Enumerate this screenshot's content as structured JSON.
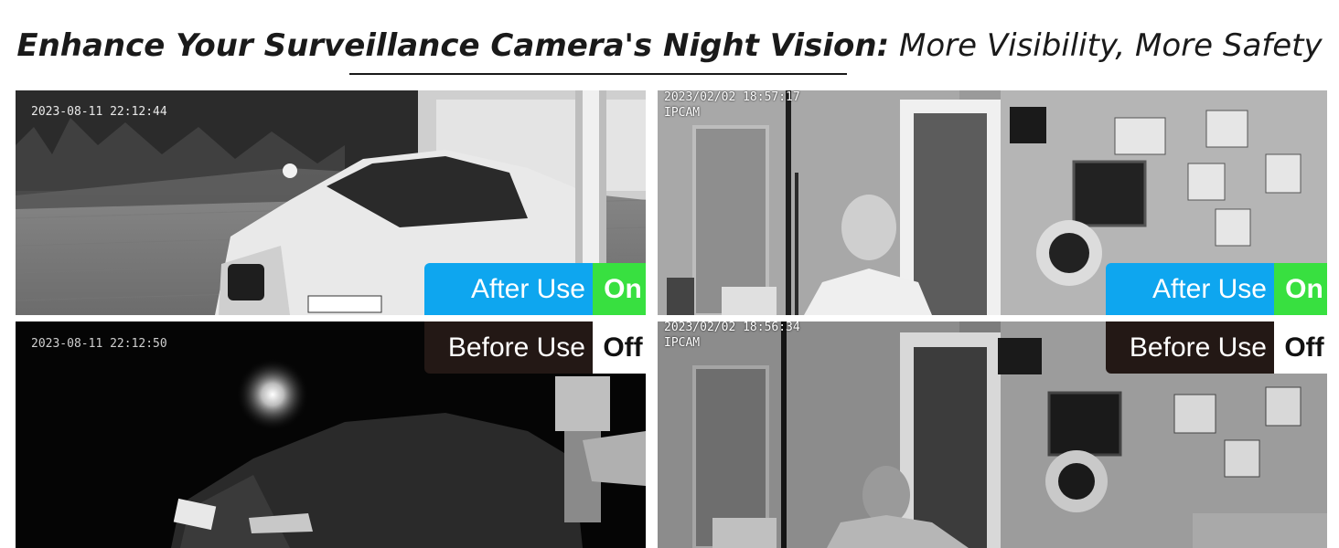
{
  "header": {
    "title_bold": "Enhance Your Surveillance Camera's Night Vision:",
    "title_light": "More Visibility, More Safety"
  },
  "panels": {
    "outdoor_after": {
      "timestamp": "2023-08-11 22:12:44",
      "badge_label": "After Use",
      "badge_state": "On"
    },
    "indoor_after": {
      "timestamp": "2023/02/02 18:57:17",
      "camera_name": "IPCAM",
      "badge_label": "After Use",
      "badge_state": "On"
    },
    "outdoor_before": {
      "timestamp": "2023-08-11 22:12:50",
      "badge_label": "Before Use",
      "badge_state": "Off"
    },
    "indoor_before": {
      "timestamp": "2023/02/02 18:56:34",
      "camera_name": "IPCAM",
      "badge_label": "Before Use",
      "badge_state": "Off"
    }
  },
  "colors": {
    "after_badge": "#0ea6ef",
    "on_badge": "#38e040",
    "before_badge": "#231815",
    "off_badge": "#ffffff"
  }
}
